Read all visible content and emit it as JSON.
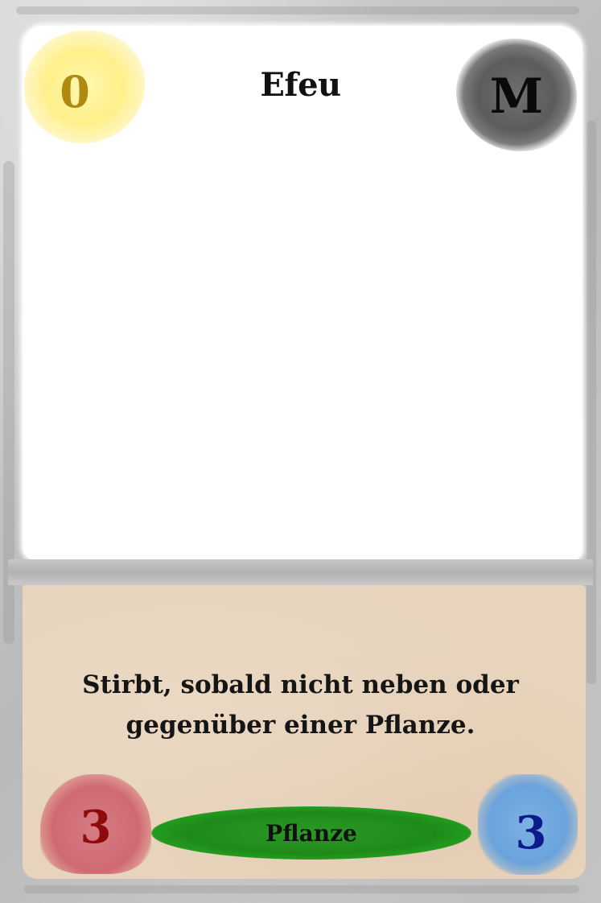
{
  "card": {
    "title": "Efeu",
    "cost": "0",
    "type_letter": "M",
    "ability": "Stirbt, sobald nicht neben oder gegenüber einer Pflanze.",
    "category": "Pflanze",
    "attack": "3",
    "life": "3"
  },
  "colors": {
    "frame": "#c4c4c4",
    "text_box": "#e8d4bd",
    "cost_blob": "#fff08a",
    "cost_text": "#b08a10",
    "type_blob": "#5c5c5c",
    "attack_blob": "#cf6a72",
    "attack_text": "#8e0b0b",
    "life_blob": "#6aa3dc",
    "life_text": "#0d1a8c",
    "category_banner": "#1f8a1a"
  }
}
